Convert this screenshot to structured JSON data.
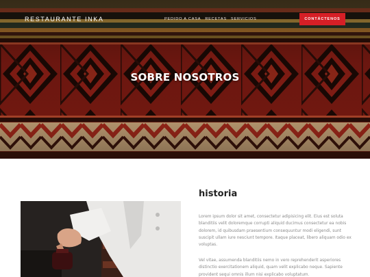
{
  "header": {
    "brand": "RESTAURANTE INKA",
    "menu": [
      "PEDIDO A CASA",
      "RECETAS",
      "SERVICIOS"
    ],
    "cta_label": "CONTÁCTENOS"
  },
  "hero": {
    "title": "SOBRE NOSOTROS"
  },
  "about": {
    "heading": "historia",
    "paragraphs": [
      "Lorem ipsum dolor sit amet, consectetur adipisicing elit. Eius est soluta blanditiis velit doloremque corrupti aliquid ducimus consectetur ea nobis dolorem, id quibusdam praesentium consequuntur modi eligendi, sunt suscipit ullam iure nesciunt tempore. Itaque placeat, libero aliquam odio ex voluptas.",
      "Vel vitae, assumenda blanditiis nemo in vero reprehenderit asperiores distinctio exercitationem aliquid, quam velit explicabo neque. Sapiente provident sequi omnis illum nisi explicabo voluptatum."
    ]
  },
  "colors": {
    "accent": "#d61f26",
    "textile_red": "#8e1f16",
    "textile_dark": "#1c0b06",
    "textile_gold": "#c99a3a"
  }
}
